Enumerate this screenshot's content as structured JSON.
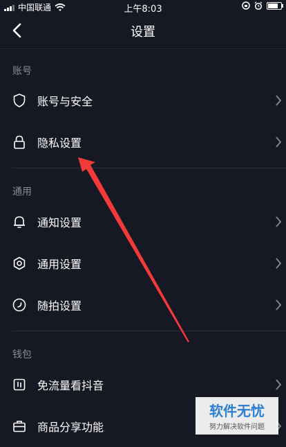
{
  "status_bar": {
    "carrier": "中国联通",
    "time": "上午8:03"
  },
  "nav": {
    "title": "设置"
  },
  "sections": [
    {
      "title": "账号",
      "items": [
        {
          "label": "账号与安全",
          "icon": "shield-icon"
        },
        {
          "label": "隐私设置",
          "icon": "lock-icon"
        }
      ]
    },
    {
      "title": "通用",
      "items": [
        {
          "label": "通知设置",
          "icon": "bell-icon"
        },
        {
          "label": "通用设置",
          "icon": "gear-icon"
        },
        {
          "label": "随拍设置",
          "icon": "clock-circle-icon"
        }
      ]
    },
    {
      "title": "钱包",
      "items": [
        {
          "label": "免流量看抖音",
          "icon": "data-card-icon"
        },
        {
          "label": "商品分享功能",
          "icon": "briefcase-icon"
        }
      ]
    }
  ],
  "watermark": {
    "main": "软件无忧",
    "sub": "努力解决软件问题"
  },
  "colors": {
    "background": "#161823",
    "annotation_arrow": "#f23a3a",
    "watermark_text": "#2d7fd0"
  }
}
